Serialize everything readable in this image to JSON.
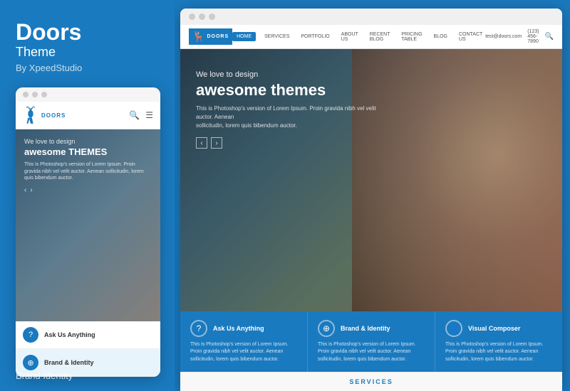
{
  "left": {
    "title": "Doors",
    "subtitle": "Theme",
    "by": "By XpeedStudio",
    "mobile": {
      "dots": [
        "",
        "",
        ""
      ],
      "logo_text": "DOORS",
      "hero": {
        "sub_text": "We love to design",
        "title": "awesome THEMES",
        "desc": "This is Photoshop's version of Lorem Ipsum. Proin gravida nibh vel velit auctor. Aenean sollicitudin, lorem quis bibendum auctor."
      },
      "cards": [
        {
          "icon": "?",
          "title": "Ask Us Anything"
        },
        {
          "icon": "⊕",
          "title": "Brand & Identity"
        }
      ]
    },
    "bottom_label": "Brand Identity"
  },
  "right": {
    "desktop": {
      "dots": [
        "",
        "",
        ""
      ],
      "nav_items": [
        "HOME",
        "SERVICES",
        "PORTFOLIO",
        "ABOUT US",
        "RECENT BLOG",
        "PRICING TABLE",
        "BLOG",
        "CONTACT US"
      ],
      "active_nav": "HOME",
      "contact_email": "test@doors.com",
      "contact_phone": "(123) 456-7890",
      "hero": {
        "sub_text": "We love to design",
        "title": "awesome THEMES",
        "desc_line1": "This is Photoshop's version of Lorem Ipsum. Proin gravida nibh vel velit auctor. Aenean",
        "desc_line2": "sollicitudin, lorem quis bibendum auctor."
      },
      "cards": [
        {
          "icon": "?",
          "title": "Ask Us Anything",
          "desc": "This is Photoshop's version of Lorem Ipsum. Proin gravida nibh vel velit auctor. Aenean sollicitudin, lorem quis bibendum auctor."
        },
        {
          "icon": "⊕",
          "title": "Brand & Identity",
          "desc": "This is Photoshop's version of Lorem Ipsum. Proin gravida nibh vel velit auctor. Aenean sollicitudin, lorem quis bibendum auctor."
        },
        {
          "icon": "☰",
          "title": "Visual Composer",
          "desc": "This is Photoshop's version of Lorem Ipsum. Proin gravida nibh vel velit auctor. Aenean sollicitudin, lorem quis bibendum auctor."
        }
      ],
      "services_label": "SERVICES"
    }
  }
}
